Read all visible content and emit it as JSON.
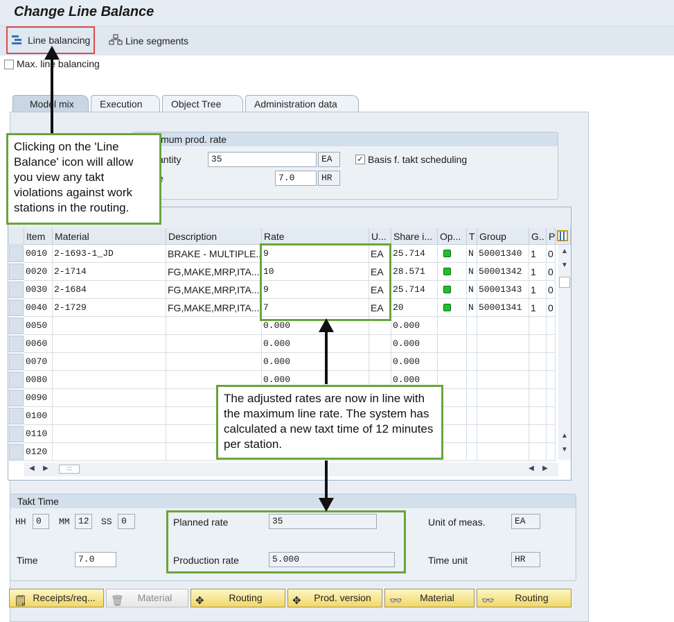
{
  "window": {
    "title": "Change Line Balance"
  },
  "toolbar": {
    "line_balancing": "Line balancing",
    "line_segments": "Line segments"
  },
  "max_line_balancing": {
    "label": "Max. line balancing",
    "checked": false
  },
  "tabs": [
    {
      "label": "Model mix",
      "active": true
    },
    {
      "label": "Execution",
      "active": false
    },
    {
      "label": "Object Tree",
      "active": false
    },
    {
      "label": "Administration data",
      "active": false
    }
  ],
  "max_prod_rate": {
    "title": "imum prod. rate",
    "quantity_label": "antity",
    "quantity_value": "35",
    "quantity_unit": "EA",
    "basis_label": "Basis f. takt scheduling",
    "basis_checked": true,
    "time_label": "e",
    "time_value": "7.0",
    "time_unit": "HR"
  },
  "table": {
    "headers": [
      "Item",
      "Material",
      "Description",
      "Rate",
      "U...",
      "Share i...",
      "Op...",
      "T",
      "Group",
      "G..",
      "P"
    ],
    "rows": [
      [
        "0010",
        "2-1693-1_JD",
        "BRAKE - MULTIPLE...",
        "9",
        "EA",
        "25.714",
        "green",
        "N",
        "50001340",
        "1",
        "0"
      ],
      [
        "0020",
        "2-1714",
        "FG,MAKE,MRP,ITA...",
        "10",
        "EA",
        "28.571",
        "green",
        "N",
        "50001342",
        "1",
        "0"
      ],
      [
        "0030",
        "2-1684",
        "FG,MAKE,MRP,ITA...",
        "9",
        "EA",
        "25.714",
        "green",
        "N",
        "50001343",
        "1",
        "0"
      ],
      [
        "0040",
        "2-1729",
        "FG,MAKE,MRP,ITA...",
        "7",
        "EA",
        "20",
        "green",
        "N",
        "50001341",
        "1",
        "0"
      ],
      [
        "0050",
        "",
        "",
        "0.000",
        "",
        "0.000",
        "",
        "",
        "",
        "",
        ""
      ],
      [
        "0060",
        "",
        "",
        "0.000",
        "",
        "0.000",
        "",
        "",
        "",
        "",
        ""
      ],
      [
        "0070",
        "",
        "",
        "0.000",
        "",
        "0.000",
        "",
        "",
        "",
        "",
        ""
      ],
      [
        "0080",
        "",
        "",
        "0.000",
        "",
        "0.000",
        "",
        "",
        "",
        "",
        ""
      ],
      [
        "0090",
        "",
        "",
        "",
        "",
        "",
        "",
        "",
        "",
        "",
        ""
      ],
      [
        "0100",
        "",
        "",
        "",
        "",
        "",
        "",
        "",
        "",
        "",
        ""
      ],
      [
        "0110",
        "",
        "",
        "",
        "",
        "",
        "",
        "",
        "",
        "",
        ""
      ],
      [
        "0120",
        "",
        "",
        "",
        "",
        "",
        "",
        "",
        "",
        "",
        ""
      ]
    ]
  },
  "takt": {
    "title": "Takt Time",
    "hh_label": "HH",
    "hh_value": "0",
    "mm_label": "MM",
    "mm_value": "12",
    "ss_label": "SS",
    "ss_value": "0",
    "time_label": "Time",
    "time_value": "7.0",
    "planned_rate_label": "Planned rate",
    "planned_rate_value": "35",
    "production_rate_label": "Production rate",
    "production_rate_value": "5.000",
    "unit_meas_label": "Unit of meas.",
    "unit_meas_value": "EA",
    "time_unit_label": "Time unit",
    "time_unit_value": "HR"
  },
  "bottom_buttons": [
    {
      "label": "Receipts/req...",
      "icon": "receipts-icon",
      "enabled": true
    },
    {
      "label": "Material",
      "icon": "trash-icon",
      "enabled": false
    },
    {
      "label": "Routing",
      "icon": "routing-icon",
      "enabled": true
    },
    {
      "label": "Prod. version",
      "icon": "prod-version-icon",
      "enabled": true
    },
    {
      "label": "Material",
      "icon": "glasses-icon",
      "enabled": true
    },
    {
      "label": "Routing",
      "icon": "glasses-icon",
      "enabled": true
    }
  ],
  "annotations": {
    "line_balance_note": "Clicking on the 'Line Balance' icon will allow you view any takt violations against work stations in the routing.",
    "rates_note": "The adjusted rates are now in line with the maximum line rate.  The system has calculated a new taxt time of 12 minutes per station."
  },
  "colors": {
    "accent_green": "#6aa43a",
    "status_green": "#1fbf2f",
    "highlight_red": "#e04a4a"
  }
}
